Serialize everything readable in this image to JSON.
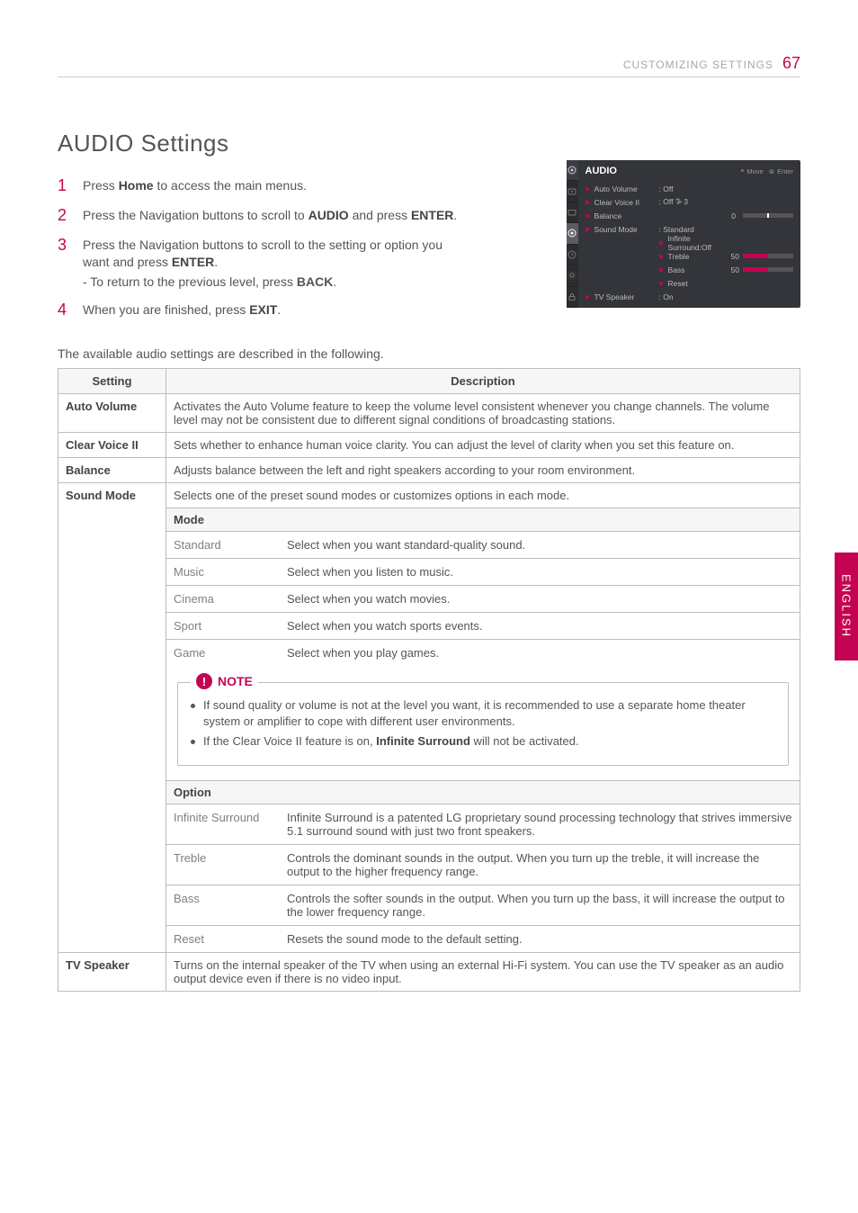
{
  "page": {
    "section": "CUSTOMIZING SETTINGS",
    "number": "67",
    "language_tab": "ENGLISH"
  },
  "title": "AUDIO Settings",
  "steps": [
    {
      "num": "1",
      "text_a": "Press ",
      "bold": "Home",
      "text_b": " to access the main menus."
    },
    {
      "num": "2",
      "text_a": "Press the Navigation buttons to scroll to ",
      "bold": "AUDIO",
      "text_b": " and press ",
      "bold2": "ENTER",
      "text_c": "."
    },
    {
      "num": "3",
      "text_a": "Press the Navigation buttons to scroll to the setting or option you want and press ",
      "bold": "ENTER",
      "text_b": "."
    },
    {
      "num": "4",
      "text_a": "When you are finished, press ",
      "bold": "EXIT",
      "text_b": "."
    }
  ],
  "substep": {
    "text_a": "- To return to the previous level, press ",
    "bold": "BACK",
    "text_b": "."
  },
  "avail": "The available audio settings are described in the following.",
  "osd": {
    "title": "AUDIO",
    "hint_move": "Move",
    "hint_enter": "Enter",
    "rows": {
      "auto_volume": {
        "label": "Auto Volume",
        "value": ": Off"
      },
      "clear_voice": {
        "label": "Clear Voice II",
        "value": ": Off ꕅ 3"
      },
      "balance": {
        "label": "Balance",
        "value": "0"
      },
      "sound_mode": {
        "label": "Sound Mode",
        "value": ": Standard"
      },
      "infinite": {
        "label": "Infinite Surround:Off"
      },
      "treble": {
        "label": "Treble",
        "value": "50"
      },
      "bass": {
        "label": "Bass",
        "value": "50"
      },
      "reset": {
        "label": "Reset"
      },
      "tv_speaker": {
        "label": "TV Speaker",
        "value": ": On"
      }
    }
  },
  "table": {
    "headers": {
      "setting": "Setting",
      "description": "Description"
    },
    "auto_volume": {
      "name": "Auto Volume",
      "desc": "Activates the Auto Volume feature to keep the volume level consistent whenever you change channels. The volume level may not be consistent due to different signal conditions of broadcasting stations."
    },
    "clear_voice": {
      "name": "Clear Voice II",
      "desc": "Sets whether to enhance human voice clarity. You can adjust the level of clarity when you set this feature on."
    },
    "balance": {
      "name": "Balance",
      "desc": "Adjusts balance between the left and right speakers according to your room environment."
    },
    "sound_mode": {
      "name": "Sound Mode",
      "intro": "Selects one of the preset sound modes or customizes options in each mode.",
      "mode_header": "Mode",
      "modes": [
        {
          "label": "Standard",
          "desc": "Select when you want standard-quality sound."
        },
        {
          "label": "Music",
          "desc": "Select when you listen to music."
        },
        {
          "label": "Cinema",
          "desc": "Select when you watch movies."
        },
        {
          "label": "Sport",
          "desc": "Select when you watch sports events."
        },
        {
          "label": "Game",
          "desc": "Select when you play games."
        }
      ],
      "option_header": "Option",
      "options": [
        {
          "label": "Infinite Surround",
          "desc": "Infinite Surround is a patented LG proprietary sound processing technology that strives immersive 5.1 surround sound with just two front speakers."
        },
        {
          "label": "Treble",
          "desc": "Controls the dominant sounds in the output. When you turn up the treble, it will increase the output to the higher frequency range."
        },
        {
          "label": "Bass",
          "desc": "Controls the softer sounds in the output. When you turn up the bass, it will increase the output to the lower frequency range."
        },
        {
          "label": "Reset",
          "desc": "Resets the sound mode to the default setting."
        }
      ]
    },
    "tv_speaker": {
      "name": "TV Speaker",
      "desc": "Turns on the internal speaker of the TV when using an external Hi-Fi system. You can use the TV speaker as an audio output device even if there is no video input."
    }
  },
  "note": {
    "label": "NOTE",
    "items": [
      {
        "text": "If sound quality or volume is not at the level you want, it is recommended to use a separate home theater system or amplifier to cope with different user environments."
      },
      {
        "pre": "If the Clear Voice II feature is on, ",
        "bold": "Infinite Surround",
        "post": " will not be activated."
      }
    ]
  }
}
